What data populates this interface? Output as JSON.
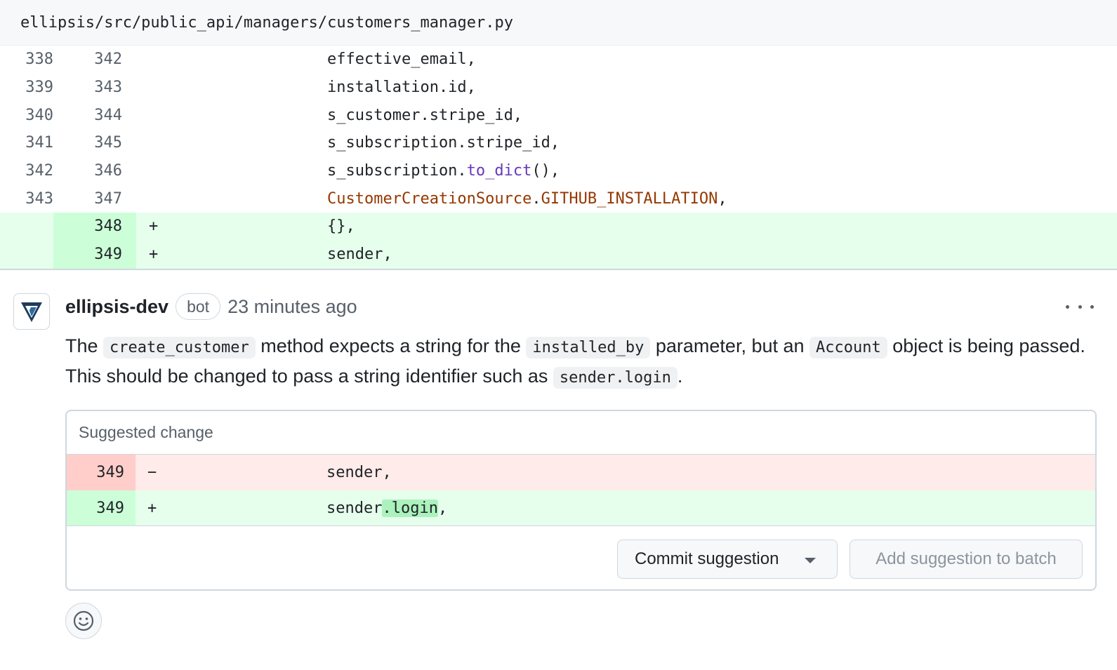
{
  "file": {
    "path": "ellipsis/src/public_api/managers/customers_manager.py"
  },
  "diff_rows": [
    {
      "old": "338",
      "new": "342",
      "marker": "",
      "code": "effective_email,",
      "type": "context"
    },
    {
      "old": "339",
      "new": "343",
      "marker": "",
      "code": "installation.id,",
      "type": "context"
    },
    {
      "old": "340",
      "new": "344",
      "marker": "",
      "code": "s_customer.stripe_id,",
      "type": "context"
    },
    {
      "old": "341",
      "new": "345",
      "marker": "",
      "code": "s_subscription.stripe_id,",
      "type": "context"
    },
    {
      "old": "342",
      "new": "346",
      "marker": "",
      "code_prefix": "s_subscription.",
      "code_fn": "to_dict",
      "code_suffix": "(),",
      "type": "context"
    },
    {
      "old": "343",
      "new": "347",
      "marker": "",
      "code_const1": "CustomerCreationSource",
      "code_dot": ".",
      "code_const2": "GITHUB_INSTALLATION",
      "code_suffix": ",",
      "type": "context"
    },
    {
      "old": "",
      "new": "348",
      "marker": "+",
      "code": "{},",
      "type": "add"
    },
    {
      "old": "",
      "new": "349",
      "marker": "+",
      "code": "sender,",
      "type": "add"
    }
  ],
  "comment": {
    "author": "ellipsis-dev",
    "badge": "bot",
    "time": "23 minutes ago",
    "body": {
      "t1": "The ",
      "c1": "create_customer",
      "t2": " method expects a string for the ",
      "c2": "installed_by",
      "t3": " parameter, but an ",
      "c3": "Account",
      "t4": " object is being passed. This should be changed to pass a string identifier such as ",
      "c4": "sender.login",
      "t5": "."
    }
  },
  "suggestion": {
    "title": "Suggested change",
    "del_row": {
      "ln": "349",
      "marker": "−",
      "code": "sender,"
    },
    "add_row": {
      "ln": "349",
      "marker": "+",
      "code_pre": "sender",
      "code_hl": ".login",
      "code_post": ","
    },
    "commit_label": "Commit suggestion",
    "batch_label": "Add suggestion to batch"
  },
  "colors": {
    "add_bg": "#e6ffec",
    "del_bg": "#ffebe9",
    "fn": "#6639ba",
    "const": "#953800"
  }
}
